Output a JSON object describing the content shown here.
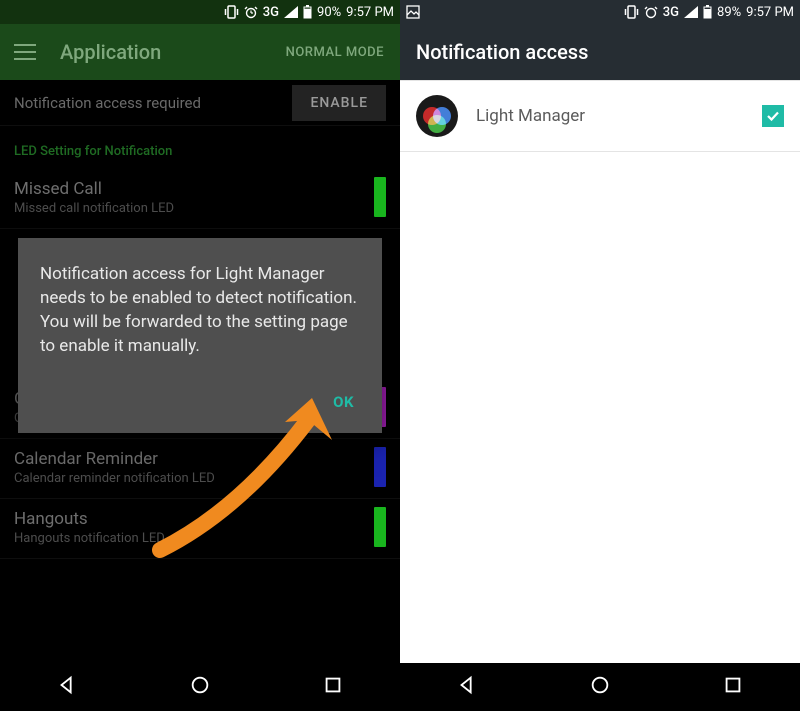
{
  "left": {
    "statusbar": {
      "network": "3G",
      "battery": "90%",
      "time": "9:57 PM"
    },
    "appbar": {
      "title": "Application",
      "mode": "NORMAL MODE"
    },
    "notif_req": {
      "text": "Notification access required",
      "button": "ENABLE"
    },
    "section": "LED Setting for Notification",
    "rows": [
      {
        "title": "Missed Call",
        "sub": "Missed call notification LED",
        "color": "#19b51e"
      },
      {
        "title": "Gmail",
        "sub": "Gmail notification LED",
        "color": "#a61fb8"
      },
      {
        "title": "Calendar Reminder",
        "sub": "Calendar reminder notification LED",
        "color": "#1a23b0"
      },
      {
        "title": "Hangouts",
        "sub": "Hangouts notification LED",
        "color": "#19b51e"
      }
    ],
    "dialog": {
      "text": "Notification access for Light Manager needs to be enabled to detect notification. You will be forwarded to the setting page to enable it manually.",
      "ok": "OK"
    }
  },
  "right": {
    "statusbar": {
      "network": "3G",
      "battery": "89%",
      "time": "9:57 PM"
    },
    "appbar": {
      "title": "Notification access"
    },
    "app": {
      "name": "Light Manager",
      "checked": true
    }
  }
}
